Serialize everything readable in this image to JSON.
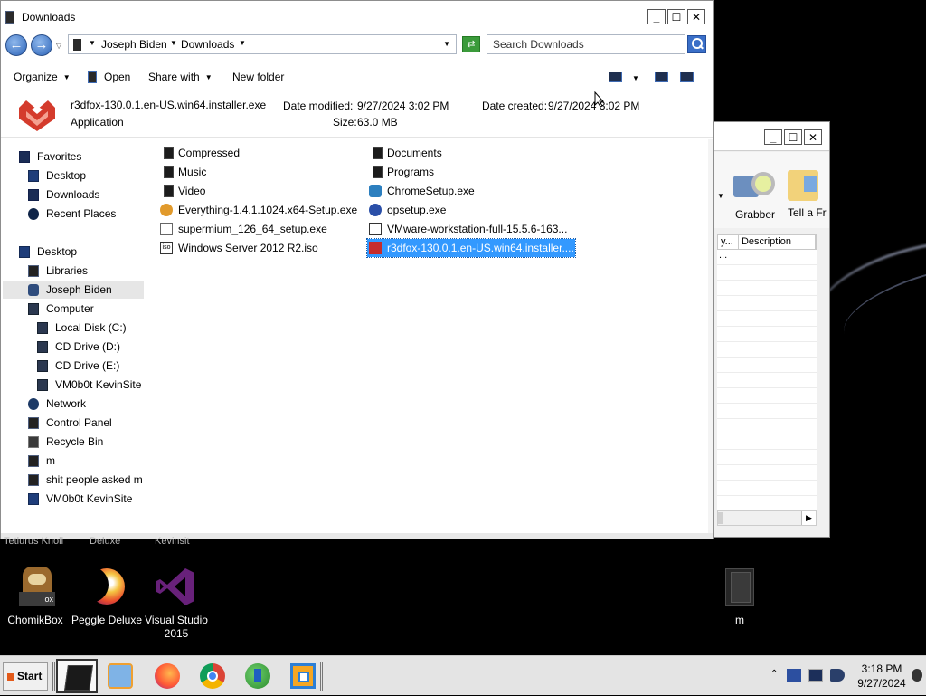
{
  "explorer": {
    "title": "Downloads",
    "breadcrumb": [
      "Joseph Biden",
      "Downloads"
    ],
    "search_placeholder": "Search Downloads",
    "toolbar": {
      "organize": "Organize",
      "open": "Open",
      "share_with": "Share with",
      "new_folder": "New folder"
    },
    "details": {
      "filename": "r3dfox-130.0.1.en-US.win64.installer.exe",
      "type": "Application",
      "date_modified_label": "Date modified:",
      "date_modified": "9/27/2024 3:02 PM",
      "size_label": "Size:",
      "size": "63.0 MB",
      "date_created_label": "Date created:",
      "date_created": "9/27/2024 3:02 PM"
    },
    "nav": [
      {
        "label": "Favorites",
        "icon": "favorites-star-icon"
      },
      {
        "label": "Desktop",
        "icon": "desktop-icon"
      },
      {
        "label": "Downloads",
        "icon": "downloads-icon"
      },
      {
        "label": "Recent Places",
        "icon": "recent-places-icon"
      },
      {
        "label": "Desktop",
        "icon": "desktop-icon"
      },
      {
        "label": "Libraries",
        "icon": "libraries-icon"
      },
      {
        "label": "Joseph Biden",
        "icon": "user-folder-icon"
      },
      {
        "label": "Computer",
        "icon": "computer-icon"
      },
      {
        "label": "Local Disk (C:)",
        "icon": "drive-icon"
      },
      {
        "label": "CD Drive (D:)",
        "icon": "cd-drive-icon"
      },
      {
        "label": "CD Drive (E:)",
        "icon": "cd-drive-icon"
      },
      {
        "label": "VM0b0t KevinSite",
        "icon": "network-drive-icon"
      },
      {
        "label": "Network",
        "icon": "network-icon"
      },
      {
        "label": "Control Panel",
        "icon": "control-panel-icon"
      },
      {
        "label": "Recycle Bin",
        "icon": "recycle-bin-icon"
      },
      {
        "label": "m",
        "icon": "folder-icon"
      },
      {
        "label": "shit people asked m",
        "icon": "folder-icon"
      },
      {
        "label": "VM0b0t KevinSite",
        "icon": "network-drive-icon"
      }
    ],
    "files": [
      {
        "name": "Compressed",
        "icon": "folder-icon"
      },
      {
        "name": "Music",
        "icon": "folder-icon"
      },
      {
        "name": "Video",
        "icon": "folder-icon"
      },
      {
        "name": "Everything-1.4.1.1024.x64-Setup.exe",
        "icon": "everything-icon"
      },
      {
        "name": "supermium_126_64_setup.exe",
        "icon": "exe-icon"
      },
      {
        "name": "Windows Server 2012 R2.iso",
        "icon": "iso-icon"
      },
      {
        "name": "Documents",
        "icon": "folder-icon"
      },
      {
        "name": "Programs",
        "icon": "folder-icon"
      },
      {
        "name": "ChromeSetup.exe",
        "icon": "chrome-setup-icon"
      },
      {
        "name": "opsetup.exe",
        "icon": "opsetup-icon"
      },
      {
        "name": "VMware-workstation-full-15.5.6-163...",
        "icon": "vmware-icon"
      },
      {
        "name": "r3dfox-130.0.1.en-US.win64.installer....",
        "icon": "r3dfox-icon"
      }
    ]
  },
  "bg_window": {
    "grabber": "Grabber",
    "tell": "Tell a Fr",
    "col_description": "Description",
    "cell": "..."
  },
  "desktop": {
    "cut_labels": [
      "Tetlurus Knoll",
      "Deluxe",
      "Kevinsit"
    ],
    "icons": [
      {
        "label": "ChomikBox",
        "icon": "chomikbox-icon"
      },
      {
        "label": "Peggle Deluxe",
        "icon": "peggle-icon"
      },
      {
        "label": "Visual Studio 2015",
        "icon": "visual-studio-icon"
      },
      {
        "label": "m",
        "icon": "folder-icon"
      }
    ]
  },
  "taskbar": {
    "start": "Start",
    "time": "3:18 PM",
    "date": "9/27/2024"
  },
  "colors": {
    "selection": "#3399ff",
    "desktop": "#000000"
  }
}
